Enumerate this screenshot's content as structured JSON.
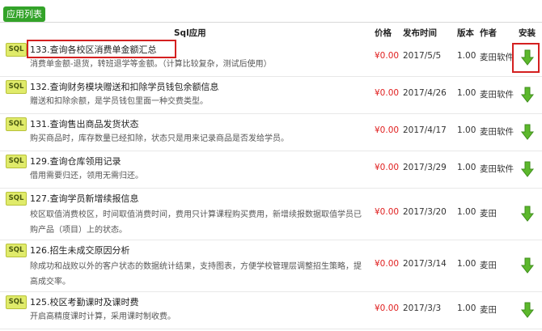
{
  "tab_label": "应用列表",
  "headers": {
    "app": "Sql应用",
    "price": "价格",
    "date": "发布时间",
    "version": "版本",
    "author": "作者",
    "install": "安装"
  },
  "badge": "SQL",
  "icons": {
    "badge": "sql-badge-icon",
    "install": "download-arrow-icon"
  },
  "colors": {
    "tab": "#33a329",
    "price": "#e02020",
    "install_arrow": "#5cb82c",
    "highlight": "#d42020"
  },
  "apps": [
    {
      "title": "133.查询各校区消费单金额汇总",
      "desc": "消费单金额-退货，转班退学等金额。（计算比较复杂，测试后使用）",
      "price": "¥0.00",
      "date": "2017/5/5",
      "version": "1.00",
      "author": "麦田软件"
    },
    {
      "title": "132.查询财务模块赠送和扣除学员钱包余额信息",
      "desc": "赠送和扣除余额，是学员钱包里面一种交费类型。",
      "price": "¥0.00",
      "date": "2017/4/26",
      "version": "1.00",
      "author": "麦田软件"
    },
    {
      "title": "131.查询售出商品发货状态",
      "desc": "购买商品时，库存数量已经扣除，状态只是用来记录商品是否发给学员。",
      "price": "¥0.00",
      "date": "2017/4/17",
      "version": "1.00",
      "author": "麦田软件"
    },
    {
      "title": "129.查询仓库领用记录",
      "desc": "借用需要归还，领用无需归还。",
      "price": "¥0.00",
      "date": "2017/3/29",
      "version": "1.00",
      "author": "麦田软件"
    },
    {
      "title": "127.查询学员新增续报信息",
      "desc": "校区取值消费校区，时间取值消费时间，费用只计算课程购买费用，新增续报数据取值学员已购产品（项目）上的状态。",
      "price": "¥0.00",
      "date": "2017/3/20",
      "version": "1.00",
      "author": "麦田"
    },
    {
      "title": "126.招生未成交原因分析",
      "desc": "除成功和战败以外的客户状态的数据统计结果，支持图表，方便学校管理层调整招生策略，提高成交率。",
      "price": "¥0.00",
      "date": "2017/3/14",
      "version": "1.00",
      "author": "麦田"
    },
    {
      "title": "125.校区考勤课时及课时费",
      "desc": "开启高精度课时计算，采用课时制收费。",
      "price": "¥0.00",
      "date": "2017/3/3",
      "version": "1.00",
      "author": "麦田"
    }
  ]
}
